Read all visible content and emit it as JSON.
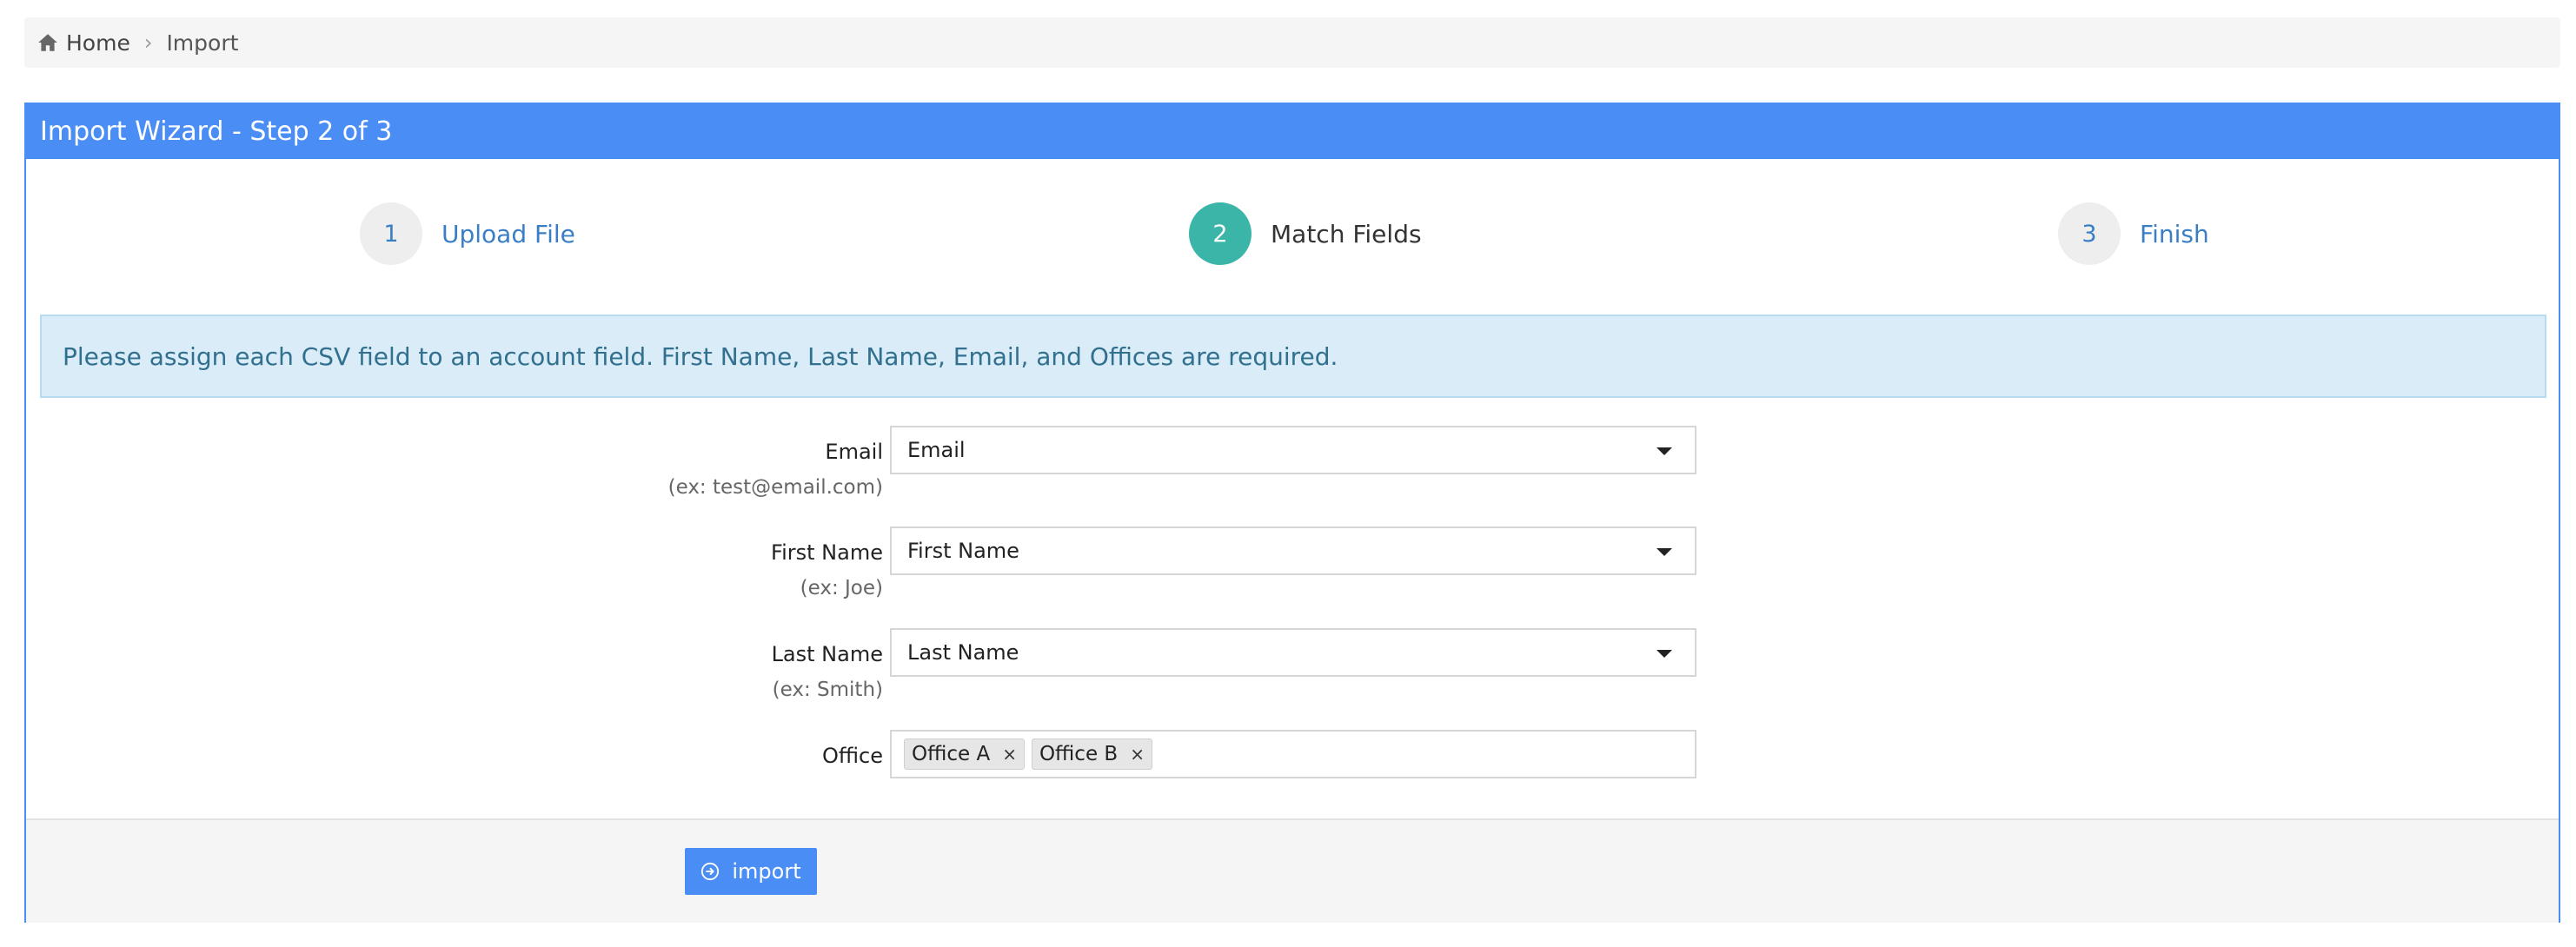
{
  "breadcrumb": {
    "home": "Home",
    "current": "Import"
  },
  "panel": {
    "title": "Import Wizard - Step 2 of 3"
  },
  "steps": [
    {
      "number": "1",
      "label": "Upload File"
    },
    {
      "number": "2",
      "label": "Match Fields"
    },
    {
      "number": "3",
      "label": "Finish"
    }
  ],
  "alert": {
    "text": "Please assign each CSV field to an account field. First Name, Last Name, Email, and Offices are required."
  },
  "fields": {
    "email": {
      "label": "Email",
      "hint": "(ex: test@email.com)",
      "value": "Email"
    },
    "first_name": {
      "label": "First Name",
      "hint": "(ex: Joe)",
      "value": "First Name"
    },
    "last_name": {
      "label": "Last Name",
      "hint": "(ex: Smith)",
      "value": "Last Name"
    },
    "office": {
      "label": "Office",
      "tags": [
        "Office A",
        "Office B"
      ],
      "remove_glyph": "×"
    }
  },
  "footer": {
    "import_label": "import"
  },
  "colors": {
    "primary": "#4a8ef5",
    "active_step": "#3ab5a8",
    "alert_bg": "#d9ecf7",
    "link": "#3a7fc5"
  }
}
